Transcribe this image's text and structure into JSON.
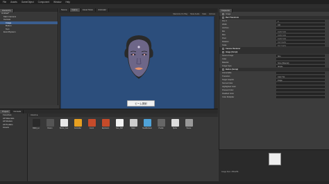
{
  "menu": [
    "File",
    "Assets",
    "GameObject",
    "Component",
    "Window",
    "Help"
  ],
  "hierarchy": {
    "tab": "Hierarchy",
    "items": [
      "Untitled*",
      "Main Camera",
      "Canvas",
      "Image",
      "Button",
      "Text",
      "EventSystem"
    ]
  },
  "scene": {
    "tabs": [
      "Scene",
      "Game",
      "Asset Store",
      "Animator"
    ],
    "bar_items": [
      "Maximize On Play",
      "Mute Audio",
      "Stats",
      "Gizmos"
    ],
    "button_text": "ビーム発射"
  },
  "inspector": {
    "tab": "Inspector",
    "object_name": "Image",
    "rows": [
      {
        "label": "Rect Transform",
        "hdr": true
      },
      {
        "label": "Pos X",
        "value": "0"
      },
      {
        "label": "Width",
        "value": "100"
      },
      {
        "label": "Anchors",
        "value": ""
      },
      {
        "label": "Min",
        "value": "X 0.5  Y 0.5"
      },
      {
        "label": "Max",
        "value": "X 0.5  Y 0.5"
      },
      {
        "label": "Pivot",
        "value": "X 0.5  Y 0.5"
      },
      {
        "label": "Rotation",
        "value": "X 0  Y 0  Z 0"
      },
      {
        "label": "Scale",
        "value": "X 1  Y 1  Z 1"
      },
      {
        "label": "Canvas Renderer",
        "hdr": true
      },
      {
        "label": "Image (Script)",
        "hdr": true
      },
      {
        "label": "Source Image",
        "value": "face"
      },
      {
        "label": "Color",
        "value": ""
      },
      {
        "label": "Material",
        "value": "None (Material)"
      },
      {
        "label": "Image Type",
        "value": "Simple"
      },
      {
        "label": "Button (Script)",
        "hdr": true
      },
      {
        "label": "Interactable",
        "value": ""
      },
      {
        "label": "Transition",
        "value": "Color Tint"
      },
      {
        "label": "Target Graphic",
        "value": "Image"
      },
      {
        "label": "Normal Color",
        "value": ""
      },
      {
        "label": "Highlighted Color",
        "value": ""
      },
      {
        "label": "Pressed Color",
        "value": ""
      },
      {
        "label": "Disabled Color",
        "value": ""
      },
      {
        "label": "Color Multiplier",
        "value": ""
      }
    ]
  },
  "project": {
    "tabs": [
      "Project",
      "Console"
    ],
    "tree": [
      "Favorites",
      "All Materials",
      "All Models",
      "All Prefabs",
      "Assets"
    ],
    "breadcrumb": "Assets ▸",
    "assets": [
      {
        "label": "B&W_Lo",
        "color": "#2a2a2a"
      },
      {
        "label": "Button",
        "color": "#555"
      },
      {
        "label": "Button_bea",
        "color": "#e8e8e8"
      },
      {
        "label": "Controller",
        "color": "#e8a020"
      },
      {
        "label": "Count",
        "color": "#c64b2a"
      },
      {
        "label": "Explosion",
        "color": "#c64b2a"
      },
      {
        "label": "face_BM",
        "color": "#f2f2f2"
      },
      {
        "label": "Main",
        "color": "#ccc"
      },
      {
        "label": "NewBehavio",
        "color": "#4fa3d9"
      },
      {
        "label": "Prefab",
        "color": "#666"
      },
      {
        "label": "Sprite",
        "color": "#ddd"
      },
      {
        "label": "Scene",
        "color": "#999"
      }
    ]
  },
  "preview": {
    "label": "Image Size: 256x256"
  },
  "colors": {
    "accent": "#3b5e8f",
    "canvas": "#2c4e7c"
  }
}
